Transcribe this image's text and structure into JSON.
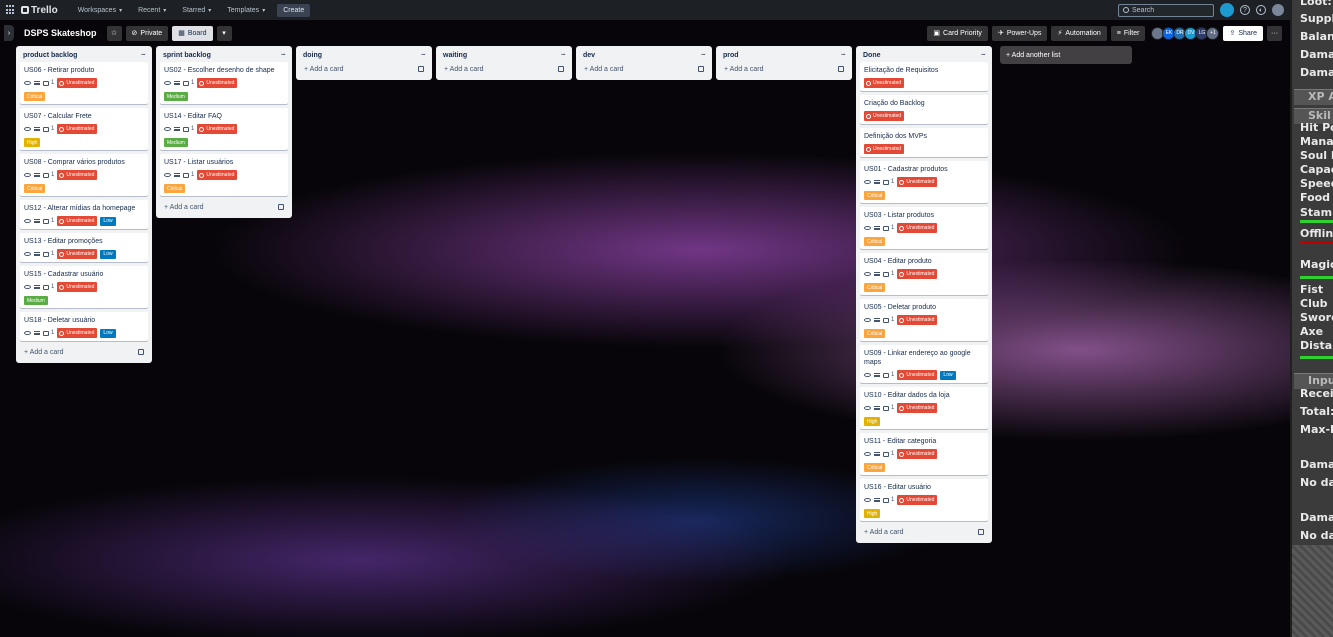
{
  "topnav": {
    "logo": "Trello",
    "workspaces": "Workspaces",
    "recent": "Recent",
    "starred": "Starred",
    "templates": "Templates",
    "create": "Create",
    "search_placeholder": "Search"
  },
  "board": {
    "title": "DSPS Skateshop",
    "visibility": "Private",
    "view": "Board",
    "card_priority": "Card Priority",
    "powerups": "Power-Ups",
    "automation": "Automation",
    "filter": "Filter",
    "members": [
      "EK",
      "DR",
      "DV",
      "LG"
    ],
    "more_members": "+1",
    "share": "Share"
  },
  "strings": {
    "unestimated": "Unestimated",
    "add_card": "Add a card",
    "add_list": "Add another list",
    "comment_count": "1"
  },
  "lists": [
    {
      "title": "product backlog",
      "cards": [
        {
          "title": "US06 - Retirar produto",
          "label": "Critical"
        },
        {
          "title": "US07 - Calcular Frete",
          "label": "High"
        },
        {
          "title": "US08 - Comprar vários produtos",
          "label": "Critical"
        },
        {
          "title": "US12 - Alterar mídias da homepage",
          "label": "Low"
        },
        {
          "title": "US13 - Editar promoções",
          "label": "Low"
        },
        {
          "title": "US15 - Cadastrar usuário",
          "label": "Medium"
        },
        {
          "title": "US18 - Deletar usuário",
          "label": "Low"
        }
      ]
    },
    {
      "title": "sprint backlog",
      "cards": [
        {
          "title": "US02 - Escolher desenho de shape",
          "label": "Medium"
        },
        {
          "title": "US14 - Editar FAQ",
          "label": "Medium"
        },
        {
          "title": "US17 - Listar usuários",
          "label": "Critical"
        }
      ]
    },
    {
      "title": "doing",
      "cards": []
    },
    {
      "title": "waiting",
      "cards": []
    },
    {
      "title": "dev",
      "cards": []
    },
    {
      "title": "prod",
      "cards": []
    },
    {
      "title": "Done",
      "cards": [
        {
          "title": "Elicitação de Requisitos",
          "simple": true
        },
        {
          "title": "Criação do Backlog",
          "simple": true
        },
        {
          "title": "Definição dos MVPs",
          "simple": true
        },
        {
          "title": "US01 - Cadastrar produtos",
          "label": "Critical"
        },
        {
          "title": "US03 - Listar produtos",
          "label": "Critical"
        },
        {
          "title": "US04 - Editar produto",
          "label": "Critical"
        },
        {
          "title": "US05 - Deletar produto",
          "label": "Critical"
        },
        {
          "title": "US09 - Linkar endereço ao google maps",
          "label": "Low"
        },
        {
          "title": "US10 - Editar dados da loja",
          "label": "High"
        },
        {
          "title": "US11 - Editar categoria",
          "label": "Critical"
        },
        {
          "title": "US16 - Editar usuário",
          "label": "High"
        }
      ]
    }
  ],
  "overlay": {
    "lines": [
      "Loot:",
      "Suppl",
      "Balanc",
      "Damag",
      "Damag"
    ],
    "xp": "XP A",
    "skills_head": "Skil",
    "skills": [
      "Hit Po",
      "Mana",
      "Soul P",
      "Capac",
      "Speed",
      "Food",
      "Stami"
    ],
    "offline": "Offlin",
    "magic": "Magic",
    "combat": [
      "Fist",
      "Club",
      "Sword",
      "Axe",
      "Dista"
    ],
    "input_head": "Inpu",
    "input": [
      "Receiv",
      "Total:",
      "Max-D"
    ],
    "damage1": "Dama",
    "nodata1": "No da",
    "damage2": "Dama",
    "nodata2": "No da"
  }
}
